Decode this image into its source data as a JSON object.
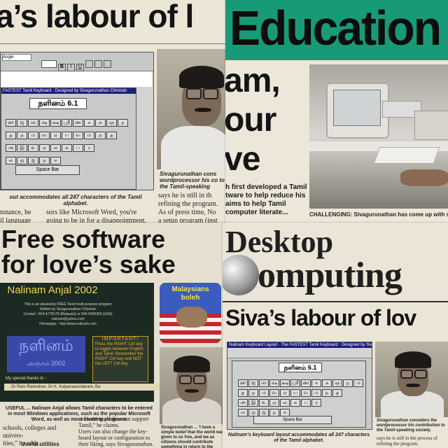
{
  "clip1": {
    "headline": "a’s labour of l",
    "window_title": "FASTEST Tamil Keyboard · Designed by Sivagurunathan Chinniah",
    "app_name": "நளினம் 6.1",
    "space_bar": "Space Bar",
    "keys_row1": [
      "ஹ",
      "ஜ",
      "ஸ",
      "ஷ",
      "க்ஷ",
      "ஸ்ரீ",
      "ண",
      "ச",
      "க",
      "ஞ",
      "ந",
      "ம"
    ],
    "keys_row2": [
      "த",
      "ந",
      "ம",
      "வ",
      "ஏ",
      "ய",
      "வ",
      "ம",
      "ந",
      "த"
    ],
    "keys_row3": [
      "அ",
      "இ",
      "உ",
      "ஏ",
      "ல",
      "க",
      "ப",
      "ர"
    ],
    "keys_row4": [
      "ல",
      "ஒ",
      "ஐ",
      "ந",
      "ச"
    ],
    "caption": "out accommodates all 247 characters of the Tamil alphabet.",
    "body_left": [
      "nstance, he",
      "il language"
    ],
    "body_mid": [
      "sors like Microsoft Word, you're",
      "going to be in for a disappointment."
    ],
    "photo_caption": "Sivagurunathan cons wordprocessor his co to the Tamil-speaking",
    "body_right": [
      "says he is still in th",
      "refining the program.",
      "As of press time, No",
      "a setup program (inst"
    ]
  },
  "clip2": {
    "banner": "Education",
    "headline": [
      "am,",
      "our",
      "ve"
    ],
    "intro": "h first developed a Tamil tware to help reduce his aims to help Tamil computer literate...",
    "caption": "CHALLENGING: Sivagurunathan has come up with six pro"
  },
  "clip3": {
    "headline": [
      "Free software",
      "for love’s sake"
    ],
    "app_title": "Nalinam Anjal 2002",
    "app_lines": [
      "This is an absolutely FREE Tamil multi-purpose program",
      "Written by Sivagurunathan Chinniah",
      "Contact : 604-4778178 (Malaysia) or 949-5990360 (USA)",
      "nalinam@yahoo.com",
      "Homepage : http://www.nalinam.com"
    ],
    "logo_text": "நளினம்",
    "logo_sub": "அஞ்சல் 2002",
    "important_title": "IMPORTANT!",
    "important_text": "Press the RIGHT Ctrl key to toggle between English and Tamil. Remember the RIGHT Ctrl key and NOT the LEFT Ctrl key.",
    "thanks": "My special thanks to :",
    "thanks_names": "Dr Ram Ravindran, Dr K. Kalyanasundaram, Ba",
    "badge_line1": "Malaysians",
    "badge_line2": "boleh",
    "caption": "USEFUL ... Nalinam Anjal allows Tamil characters to be entered in most Windows applications, such as the popular Microsoft Word, as well as most chatting programs",
    "body_left": [
      "schools, colleges and univers-",
      "ities,” he adds."
    ],
    "subhead": "Useful utilities",
    "body_mid": [
      "software itself does not support",
      "Tamil,” he claims.",
      "Users can also change the key-",
      "board layout or configuration to",
      "their liking, says Sivagurunathan."
    ],
    "photo_caption": "Sivagurunathan ... 'I have a simple belief that the world was given to us free, and we as citizens should contribute something in return to the world.'"
  },
  "clip4": {
    "masthead_d": "Desktop",
    "masthead_c": "omputing",
    "headline": "Siva’s labour of lov",
    "window_title": "Nalinam Keyboard Layout · The FASTEST Tamil Keyboard · Designed by Sivagurunathan Chinniah",
    "app_name": "நளினம் 6.1",
    "space_bar": "Space Bar",
    "caption": "Nalinam’s keyboard layout accommodates all 247 characters of the Tamil alphabet.",
    "photo_caption": "Sivagurunathan considers the wordprocessor his contribution to the Tamil-speaking society.",
    "body_right": [
      "says he is still in the process of",
      "refining the program."
    ]
  }
}
